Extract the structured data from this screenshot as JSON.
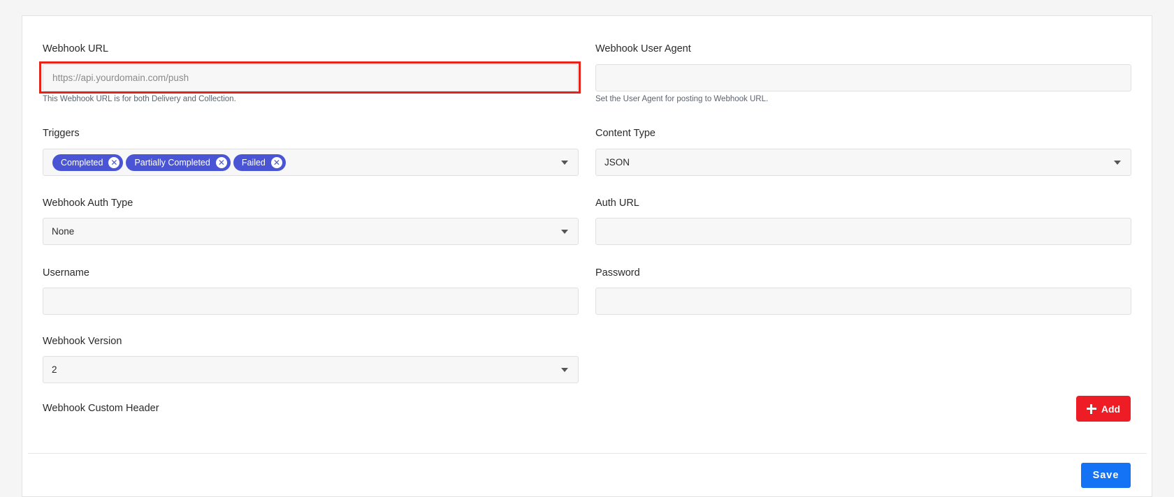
{
  "webhook_url": {
    "label": "Webhook URL",
    "placeholder": "https://api.yourdomain.com/push",
    "value": "",
    "help": "This Webhook URL is for both Delivery and Collection."
  },
  "webhook_user_agent": {
    "label": "Webhook User Agent",
    "value": "",
    "help": "Set the User Agent for posting to Webhook URL."
  },
  "triggers": {
    "label": "Triggers",
    "chips": [
      "Completed",
      "Partially Completed",
      "Failed"
    ],
    "remove_glyph": "✕"
  },
  "content_type": {
    "label": "Content Type",
    "value": "JSON"
  },
  "webhook_auth_type": {
    "label": "Webhook Auth Type",
    "value": "None"
  },
  "auth_url": {
    "label": "Auth URL",
    "value": ""
  },
  "username": {
    "label": "Username",
    "value": ""
  },
  "password": {
    "label": "Password",
    "value": ""
  },
  "webhook_version": {
    "label": "Webhook Version",
    "value": "2"
  },
  "custom_header": {
    "label": "Webhook Custom Header",
    "add_label": "Add"
  },
  "footer": {
    "save_label": "Save"
  },
  "colors": {
    "chip": "#4a55d6",
    "add_button": "#ee1c24",
    "save_button": "#1472f5",
    "highlight": "#e5231b"
  }
}
